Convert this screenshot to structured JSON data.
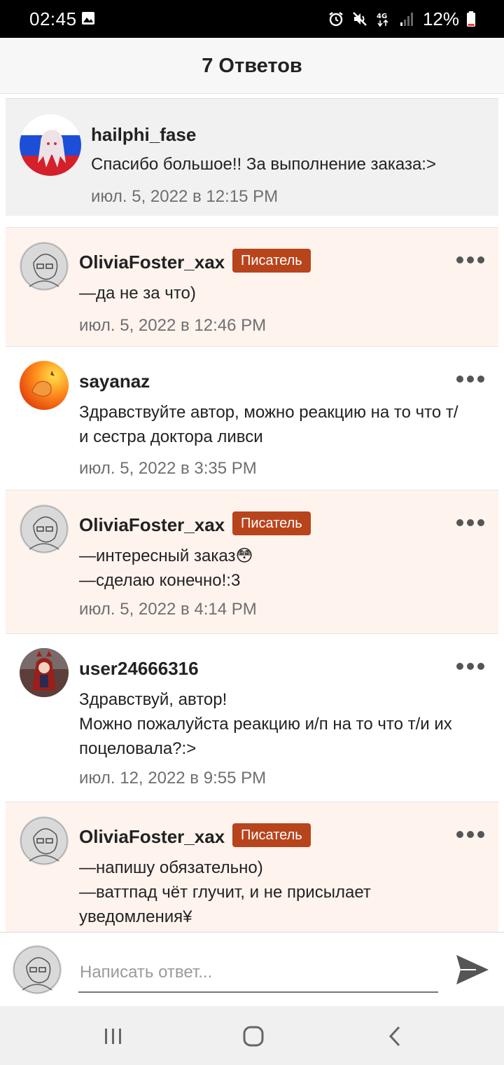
{
  "status_bar": {
    "time": "02:45",
    "battery": "12%",
    "icons": [
      "image-icon",
      "alarm-icon",
      "mute-icon",
      "network-4g-icon",
      "signal-icon",
      "battery-icon"
    ]
  },
  "header": {
    "title": "7 Ответов"
  },
  "parent_comment": {
    "username": "hailphi_fase",
    "text": "Спасибо большое!! За выполнение заказа:>",
    "time": "июл. 5, 2022 в 12:15 PM"
  },
  "replies": [
    {
      "username": "OliviaFoster_xax",
      "badge": "Писатель",
      "lines": [
        "—да не за что)"
      ],
      "time": "июл. 5, 2022 в 12:46 PM"
    },
    {
      "username": "sayanaz",
      "badge": "",
      "lines": [
        "Здравствуйте автор, можно реакцию на то что т/",
        "и сестра доктора ливси"
      ],
      "time": "июл. 5, 2022 в 3:35 PM"
    },
    {
      "username": "OliviaFoster_xax",
      "badge": "Писатель",
      "lines": [
        "—интересный заказ😳",
        "—сделаю конечно!:3"
      ],
      "time": "июл. 5, 2022 в 4:14 PM"
    },
    {
      "username": "user24666316",
      "badge": "",
      "lines": [
        "Здравствуй, автор!",
        "Можно пожалуйста реакцию и/п на то что т/и их",
        "поцеловала?:>"
      ],
      "time": "июл. 12, 2022 в 9:55 PM"
    },
    {
      "username": "OliviaFoster_xax",
      "badge": "Писатель",
      "lines": [
        "—напишу обязательно)",
        "—ваттпад чёт глучит, и не присылает",
        "уведомления¥"
      ],
      "time": ""
    }
  ],
  "composer": {
    "placeholder": "Написать ответ..."
  },
  "colors": {
    "badge": "#b8441c",
    "author_bg": "#fff3ee",
    "parent_bg": "#f1f1f1"
  }
}
